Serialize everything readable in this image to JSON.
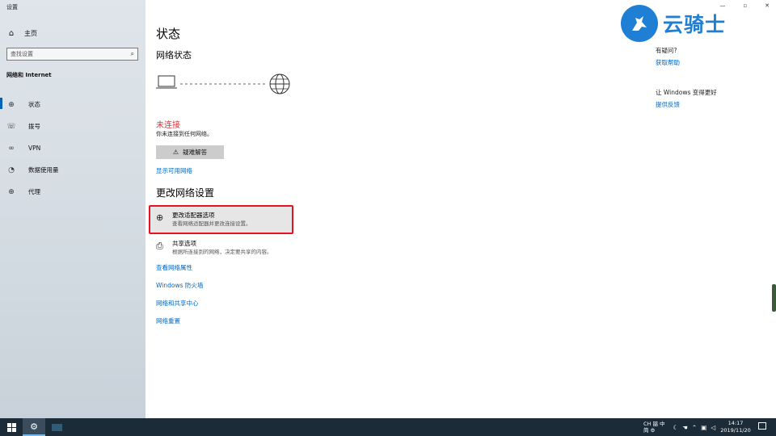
{
  "window": {
    "title": "设置",
    "controls": [
      "—",
      "▫",
      "✕"
    ]
  },
  "sidebar": {
    "home_label": "主页",
    "search_placeholder": "查找设置",
    "section_label": "网络和 Internet",
    "items": [
      {
        "label": "状态",
        "icon": "globe-status-icon",
        "active": true
      },
      {
        "label": "拨号",
        "icon": "dialup-icon",
        "active": false
      },
      {
        "label": "VPN",
        "icon": "vpn-icon",
        "active": false
      },
      {
        "label": "数据使用量",
        "icon": "data-usage-icon",
        "active": false
      },
      {
        "label": "代理",
        "icon": "proxy-globe-icon",
        "active": false
      }
    ]
  },
  "main": {
    "title": "状态",
    "network_status_heading": "网络状态",
    "status_text": "未连接",
    "status_desc": "你未连接到任何网络。",
    "troubleshoot_label": "疑难解答",
    "show_networks_link": "显示可用网络",
    "change_settings_heading": "更改网络设置",
    "options": [
      {
        "title": "更改适配器选项",
        "desc": "查看网络适配器并更改连接设置。",
        "icon": "adapter-globe-icon"
      },
      {
        "title": "共享选项",
        "desc": "根据所连接到的网络，决定要共享的内容。",
        "icon": "share-printer-icon"
      }
    ],
    "links": [
      "查看网络属性",
      "Windows 防火墙",
      "网络和共享中心",
      "网络重置"
    ]
  },
  "right_panel": {
    "question_label": "有疑问?",
    "help_link": "获取帮助",
    "feedback_label": "让 Windows 变得更好",
    "feedback_link": "提供反馈"
  },
  "watermark": {
    "text": "云骑士"
  },
  "taskbar": {
    "ime": {
      "row1": [
        "CH",
        "㗊",
        "中"
      ],
      "row2": [
        "简",
        "⚙"
      ]
    },
    "clock_time": "14:17",
    "clock_date": "2019/11/20"
  },
  "colors": {
    "accent": "#0063b1",
    "link": "#0067c0",
    "error": "#d13438",
    "highlight": "#e81123"
  }
}
